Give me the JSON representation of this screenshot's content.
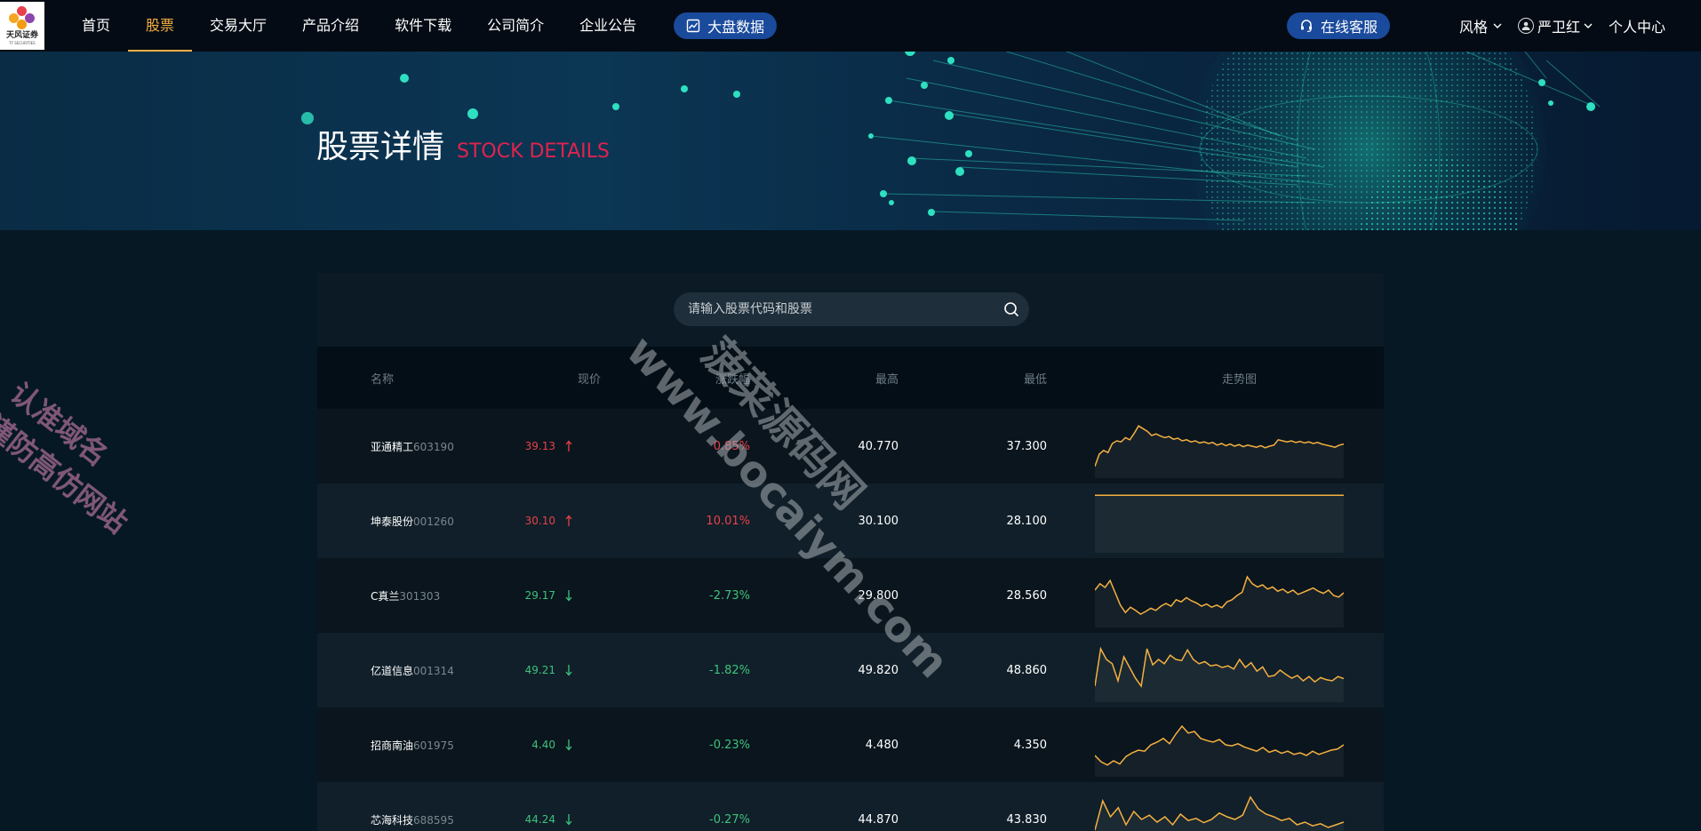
{
  "brand": {
    "logo_text": "天风证券",
    "logo_subtext": "TF SECURITIES"
  },
  "nav": {
    "items": [
      {
        "label": "首页",
        "active": false
      },
      {
        "label": "股票",
        "active": true
      },
      {
        "label": "交易大厅",
        "active": false
      },
      {
        "label": "产品介绍",
        "active": false
      },
      {
        "label": "软件下载",
        "active": false
      },
      {
        "label": "公司简介",
        "active": false
      },
      {
        "label": "企业公告",
        "active": false
      }
    ],
    "big_data_label": "大盘数据",
    "service_label": "在线客服",
    "style_label": "风格",
    "user_name": "严卫红",
    "personal_center": "个人中心"
  },
  "banner": {
    "title_cn": "股票详情",
    "title_en": "STOCK DETAILS"
  },
  "search": {
    "placeholder": "请输入股票代码和股票"
  },
  "table": {
    "headers": {
      "name": "名称",
      "price": "现价",
      "change": "涨跌幅",
      "high": "最高",
      "low": "最低",
      "trend": "走势图"
    },
    "rows": [
      {
        "name": "亚通精工",
        "code": "603190",
        "price": "39.13",
        "direction": "up",
        "change": "0.85%",
        "high": "40.770",
        "low": "37.300",
        "trend": [
          0.12,
          0.35,
          0.42,
          0.38,
          0.55,
          0.6,
          0.58,
          0.66,
          0.62,
          0.74,
          0.88,
          0.83,
          0.78,
          0.7,
          0.73,
          0.69,
          0.66,
          0.68,
          0.63,
          0.65,
          0.6,
          0.62,
          0.58,
          0.6,
          0.56,
          0.58,
          0.55,
          0.57,
          0.52,
          0.55,
          0.51,
          0.54,
          0.5,
          0.53,
          0.49,
          0.52,
          0.5,
          0.48,
          0.51,
          0.47,
          0.5,
          0.52,
          0.62,
          0.6,
          0.58,
          0.6,
          0.57,
          0.59,
          0.56,
          0.58,
          0.55,
          0.57,
          0.54,
          0.52,
          0.5,
          0.48,
          0.52,
          0.54
        ]
      },
      {
        "name": "坤泰股份",
        "code": "001260",
        "price": "30.10",
        "direction": "up",
        "change": "10.01%",
        "high": "30.100",
        "low": "28.100",
        "trend": [
          0.98,
          0.98,
          0.98,
          0.98,
          0.98,
          0.98,
          0.98,
          0.98,
          0.98,
          0.98
        ]
      },
      {
        "name": "C真兰",
        "code": "301303",
        "price": "29.17",
        "direction": "down",
        "change": "-2.73%",
        "high": "29.800",
        "low": "28.560",
        "trend": [
          0.6,
          0.72,
          0.65,
          0.78,
          0.55,
          0.32,
          0.18,
          0.28,
          0.22,
          0.15,
          0.2,
          0.26,
          0.22,
          0.3,
          0.35,
          0.3,
          0.42,
          0.38,
          0.46,
          0.4,
          0.36,
          0.3,
          0.34,
          0.28,
          0.32,
          0.27,
          0.38,
          0.42,
          0.5,
          0.56,
          0.85,
          0.72,
          0.66,
          0.7,
          0.62,
          0.66,
          0.58,
          0.62,
          0.55,
          0.6,
          0.52,
          0.56,
          0.6,
          0.64,
          0.58,
          0.54,
          0.6,
          0.5,
          0.47,
          0.55
        ]
      },
      {
        "name": "亿道信息",
        "code": "001314",
        "price": "49.21",
        "direction": "down",
        "change": "-1.82%",
        "high": "49.820",
        "low": "48.860",
        "trend": [
          0.2,
          0.9,
          0.7,
          0.62,
          0.3,
          0.75,
          0.55,
          0.35,
          0.2,
          0.9,
          0.6,
          0.7,
          0.62,
          0.78,
          0.7,
          0.68,
          0.88,
          0.7,
          0.62,
          0.66,
          0.58,
          0.6,
          0.55,
          0.58,
          0.52,
          0.7,
          0.55,
          0.64,
          0.48,
          0.56,
          0.38,
          0.4,
          0.5,
          0.42,
          0.35,
          0.4,
          0.3,
          0.38,
          0.28,
          0.36,
          0.32,
          0.3,
          0.38,
          0.34
        ]
      },
      {
        "name": "招商南油",
        "code": "601975",
        "price": "4.40",
        "direction": "down",
        "change": "-0.23%",
        "high": "4.480",
        "low": "4.350",
        "trend": [
          0.3,
          0.18,
          0.12,
          0.2,
          0.14,
          0.28,
          0.35,
          0.4,
          0.38,
          0.5,
          0.55,
          0.62,
          0.52,
          0.7,
          0.85,
          0.72,
          0.75,
          0.62,
          0.58,
          0.55,
          0.6,
          0.5,
          0.48,
          0.52,
          0.46,
          0.42,
          0.38,
          0.45,
          0.36,
          0.4,
          0.34,
          0.38,
          0.32,
          0.35,
          0.3,
          0.38,
          0.32,
          0.36,
          0.4,
          0.42,
          0.5
        ]
      },
      {
        "name": "芯海科技",
        "code": "688595",
        "price": "44.24",
        "direction": "down",
        "change": "-0.27%",
        "high": "44.870",
        "low": "43.830",
        "trend": [
          0.3,
          0.85,
          0.55,
          0.72,
          0.4,
          0.65,
          0.5,
          0.58,
          0.45,
          0.55,
          0.4,
          0.6,
          0.48,
          0.52,
          0.44,
          0.5,
          0.62,
          0.55,
          0.5,
          0.58,
          0.92,
          0.7,
          0.6,
          0.55,
          0.48,
          0.52,
          0.4,
          0.45,
          0.38,
          0.42,
          0.35,
          0.4,
          0.45
        ]
      }
    ]
  },
  "watermark": {
    "line1": "认准域名",
    "line2": "谨防高仿网站",
    "site_cn": "菠菜源码网",
    "site_url": "www.bocaiym.com"
  },
  "colors": {
    "accent": "#f5b041",
    "up": "#e8414b",
    "down": "#3ec27c",
    "pill": "#1a4a9c",
    "en_title": "#e0234e"
  }
}
